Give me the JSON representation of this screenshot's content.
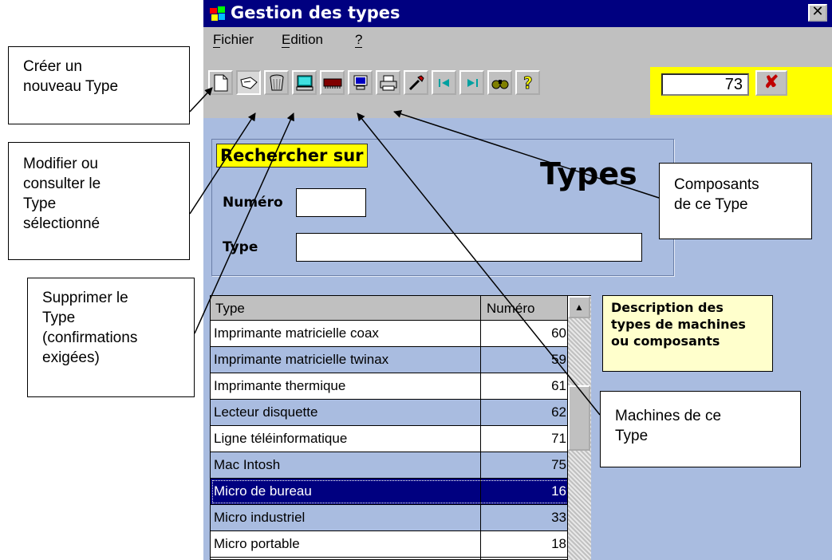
{
  "window": {
    "title": "Gestion des types",
    "close_label": "✕"
  },
  "menu": {
    "fichier": "Fichier",
    "edition": "Edition",
    "help": "?"
  },
  "toolbar": {
    "icons": [
      "new-document-icon",
      "edit-hand-icon",
      "trash-icon",
      "computer-icon",
      "memory-chip-icon",
      "monitor-icon",
      "printer-icon",
      "eyedropper-icon",
      "first-record-icon",
      "last-record-icon",
      "binoculars-icon",
      "help-question-icon"
    ],
    "record_number": "73",
    "cancel_label": "✘"
  },
  "search": {
    "label": "Rechercher sur",
    "numero_label": "Numéro",
    "numero_value": "",
    "type_label": "Type",
    "type_value": ""
  },
  "page_title": "Types",
  "grid": {
    "columns": [
      "Type",
      "Numéro"
    ],
    "rows": [
      {
        "type": "Imprimante matricielle coax",
        "numero": "60"
      },
      {
        "type": "Imprimante matricielle twinax",
        "numero": "59"
      },
      {
        "type": "Imprimante thermique",
        "numero": "61"
      },
      {
        "type": "Lecteur disquette",
        "numero": "62"
      },
      {
        "type": "Ligne téléinformatique",
        "numero": "71"
      },
      {
        "type": "Mac Intosh",
        "numero": "75"
      },
      {
        "type": "Micro de bureau",
        "numero": "16"
      },
      {
        "type": "Micro industriel",
        "numero": "33"
      },
      {
        "type": "Micro portable",
        "numero": "18"
      }
    ],
    "selected_index": 6
  },
  "description": {
    "line1": "Description des",
    "line2": "types de machines",
    "line3": "ou composants"
  },
  "callouts": {
    "creer": [
      "Créer un",
      "nouveau Type"
    ],
    "modifier": [
      "Modifier ou",
      "consulter le",
      "Type",
      "sélectionné"
    ],
    "supprimer": [
      "Supprimer le",
      "Type",
      "(confirmations",
      "exigées)"
    ],
    "composants": [
      "Composants",
      "de ce Type"
    ],
    "machines": [
      "Machines de ce",
      "Type"
    ]
  },
  "colors": {
    "titlebar": "#000080",
    "window_bg": "#a9bce0",
    "highlight_yellow": "#ffff00",
    "selected_row": "#000080",
    "alt_row": "#a9bce0"
  }
}
